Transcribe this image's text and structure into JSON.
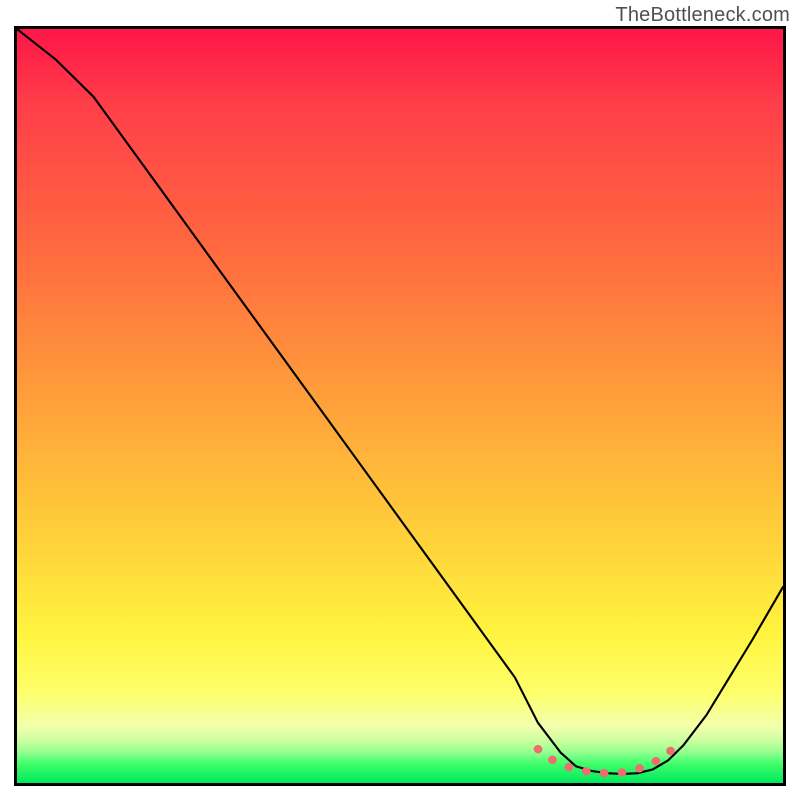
{
  "watermark": "TheBottleneck.com",
  "chart_data": {
    "type": "line",
    "title": "",
    "xlabel": "",
    "ylabel": "",
    "xlim": [
      0,
      100
    ],
    "ylim": [
      0,
      100
    ],
    "series": [
      {
        "name": "bottleneck-curve",
        "x": [
          0,
          5,
          10,
          15,
          20,
          25,
          30,
          35,
          40,
          45,
          50,
          55,
          60,
          65,
          68,
          71,
          73,
          75,
          77,
          79,
          81,
          83,
          85,
          87,
          90,
          93,
          96,
          100
        ],
        "y": [
          100,
          96,
          91,
          84,
          77,
          70,
          63,
          56,
          49,
          42,
          35,
          28,
          21,
          14,
          8,
          4,
          2.2,
          1.6,
          1.3,
          1.2,
          1.3,
          1.8,
          3.0,
          5.0,
          9.0,
          14,
          19,
          26
        ]
      }
    ],
    "optimal_band": {
      "name": "optimal-range-marker",
      "x": [
        68,
        70,
        72,
        74,
        76,
        78,
        80,
        82,
        84,
        86
      ],
      "y": [
        4.5,
        3.0,
        2.1,
        1.6,
        1.3,
        1.3,
        1.5,
        2.2,
        3.2,
        4.8
      ]
    },
    "background_gradient": {
      "top": "#ff1648",
      "upper_mid": "#ffa23a",
      "mid": "#fff33e",
      "lower": "#c8ff9e",
      "bottom": "#00e85e"
    }
  }
}
